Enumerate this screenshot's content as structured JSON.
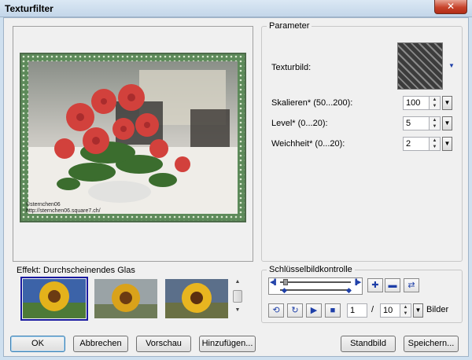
{
  "window": {
    "title": "Texturfilter",
    "close_glyph": "✕"
  },
  "watermark": {
    "line1": "©sternchen06",
    "line2": "http://sternchen06.square7.ch/"
  },
  "parameter": {
    "group_label": "Parameter",
    "texture_label": "Texturbild:",
    "texture_dropdown_glyph": "▼",
    "rows": [
      {
        "label": "Skalieren* (50...200):",
        "value": "100"
      },
      {
        "label": "Level* (0...20):",
        "value": "5"
      },
      {
        "label": "Weichheit* (0...20):",
        "value": "2"
      }
    ]
  },
  "effect": {
    "label": "Effekt: Durchscheinendes Glas",
    "thumbnails": [
      "sunflower-glass-1",
      "sunflower-glass-2",
      "sunflower-glass-3"
    ],
    "selected_index": 0
  },
  "keyframe": {
    "group_label": "Schlüsselbildkontrolle",
    "current_frame": "1",
    "separator": "/",
    "total_frames": "10",
    "frames_label": "Bilder"
  },
  "buttons": {
    "ok": "OK",
    "cancel": "Abbrechen",
    "preview": "Vorschau",
    "add": "Hinzufügen...",
    "default_image": "Standbild",
    "save": "Speichern..."
  },
  "colors": {
    "accent": "#1e3fa8",
    "frame_green": "#4d6b4a"
  }
}
